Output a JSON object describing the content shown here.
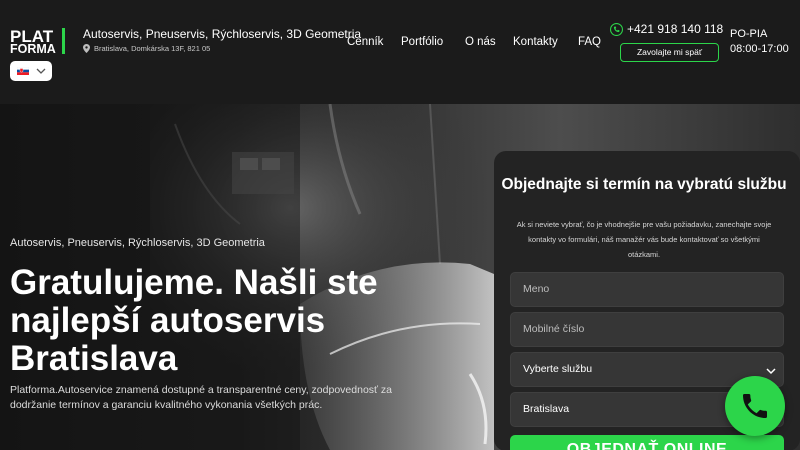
{
  "header": {
    "logo": {
      "line1": "PLAT",
      "line2": "FORMA"
    },
    "language": {
      "selected": "SK",
      "flag_icon": "slovak-flag-icon"
    },
    "services": "Autoservis, Pneuservis, Rýchloservis, 3D Geometria",
    "address": "Bratislava, Domkárska 13F, 821 05",
    "nav": [
      {
        "label": "Cenník"
      },
      {
        "label": "Portfólio"
      },
      {
        "label": "O nás"
      },
      {
        "label": "Kontakty"
      },
      {
        "label": "FAQ"
      }
    ],
    "phone": "+421 918 140 118",
    "callback_label": "Zavolajte mi späť",
    "hours_days": "PO-PIA",
    "hours_time": "08:00-17:00"
  },
  "hero": {
    "subtitle": "Autoservis, Pneuservis, Rýchloservis, 3D Geometria",
    "title": "Gratulujeme. Našli ste najlepší autoservis Bratislava",
    "description": "Platforma.Autoservice znamená dostupné a transparentné ceny, zodpovednosť za dodržanie termínov a garanciu kvalitného vykonania všetkých prác."
  },
  "form": {
    "title": "Objednajte si termín na vybratú službu",
    "description": "Ak si neviete vybrať, čo je vhodnejšie pre vašu požiadavku, zanechajte svoje kontakty vo formulári, náš manažér vás bude kontaktovať so všetkými otázkami.",
    "name_placeholder": "Meno",
    "phone_placeholder": "Mobilné číslo",
    "service_select": "Vyberte službu",
    "city_select": "Bratislava",
    "submit_label": "OBJEDNAŤ ONLINE"
  },
  "colors": {
    "accent": "#2cd54a",
    "background": "#1b1b1b",
    "form_bg": "#232323",
    "field_bg": "#363636"
  }
}
